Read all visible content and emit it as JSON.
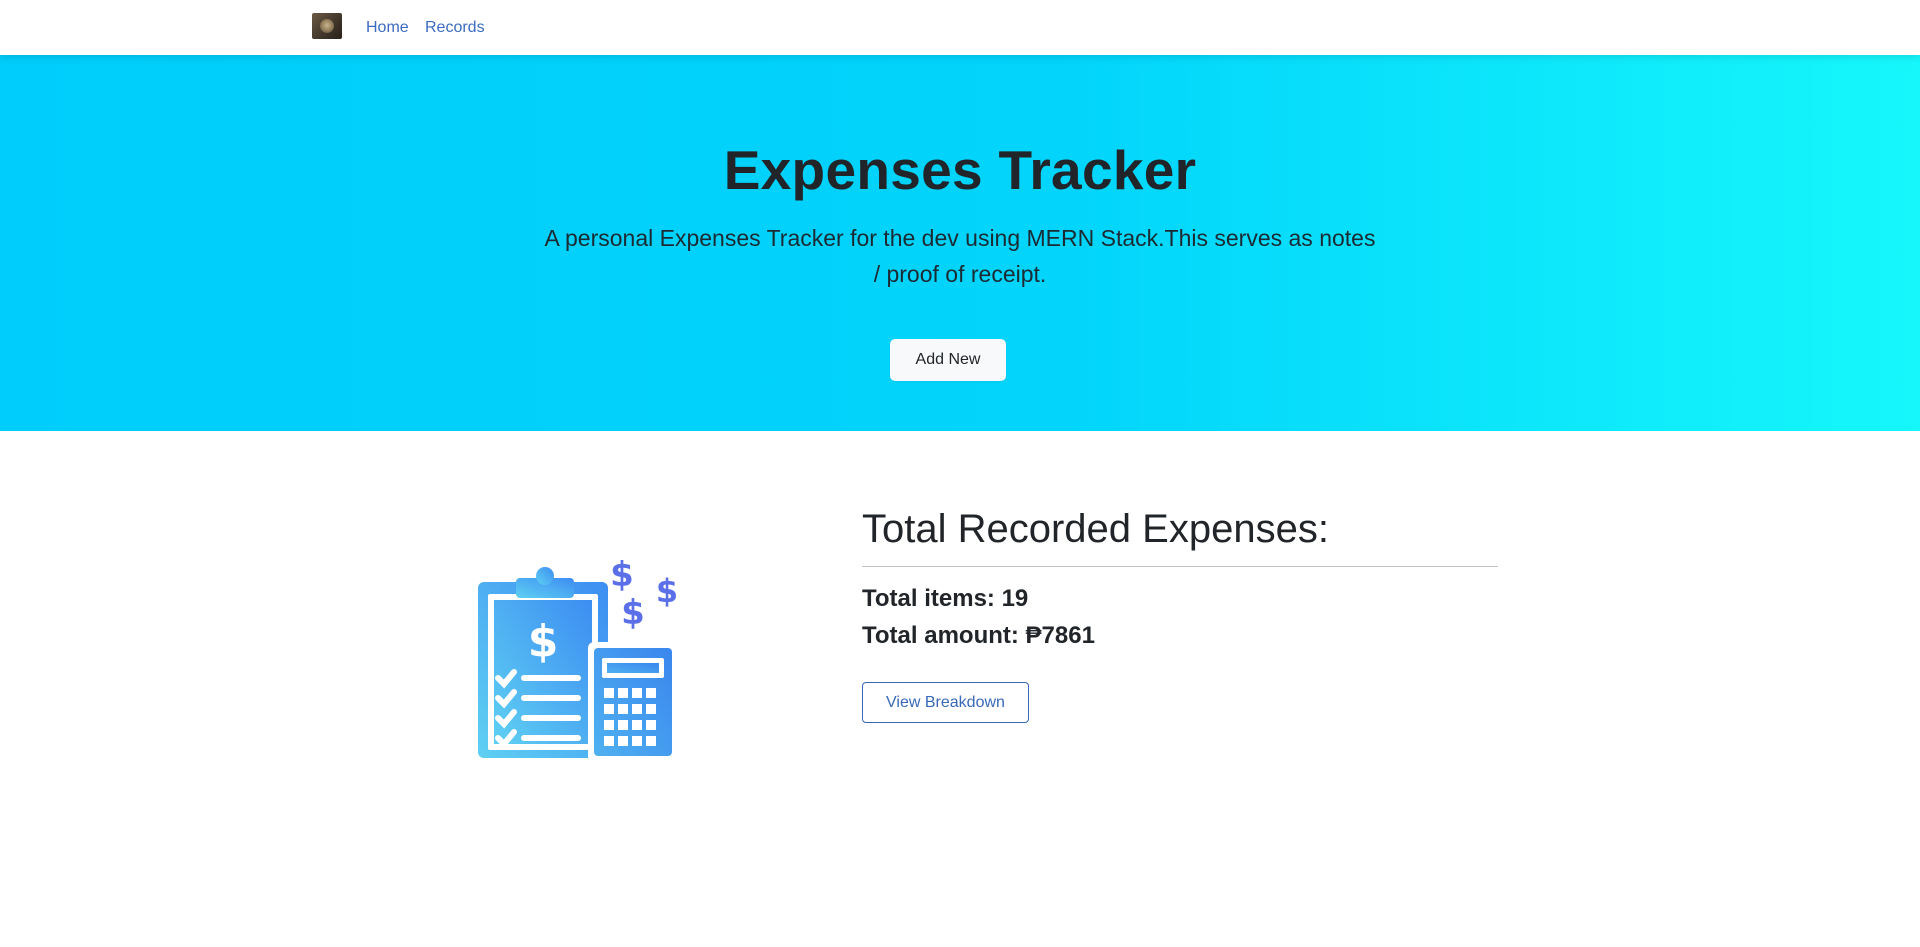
{
  "nav": {
    "avatar_icon": "dog-avatar-icon",
    "links": [
      {
        "label": "Home"
      },
      {
        "label": "Records"
      }
    ]
  },
  "hero": {
    "title": "Expenses Tracker",
    "description": "A personal Expenses Tracker for the dev using MERN Stack.This serves as notes / proof of receipt.",
    "add_button_label": "Add New"
  },
  "summary": {
    "illustration_icon": "clipboard-calculator-dollar-icon",
    "title": "Total Recorded Expenses:",
    "items_label": "Total items:",
    "items_value": "19",
    "amount_label": "Total amount:",
    "amount_value": "₱7861",
    "breakdown_button_label": "View Breakdown"
  },
  "colors": {
    "hero_gradient_start": "#00cdfb",
    "hero_gradient_end": "#15f7fb",
    "link": "#3c6bc0",
    "outline_button": "#3a69b7",
    "illustration_light": "#5fd0f2",
    "illustration_dark": "#5a6fe8"
  }
}
